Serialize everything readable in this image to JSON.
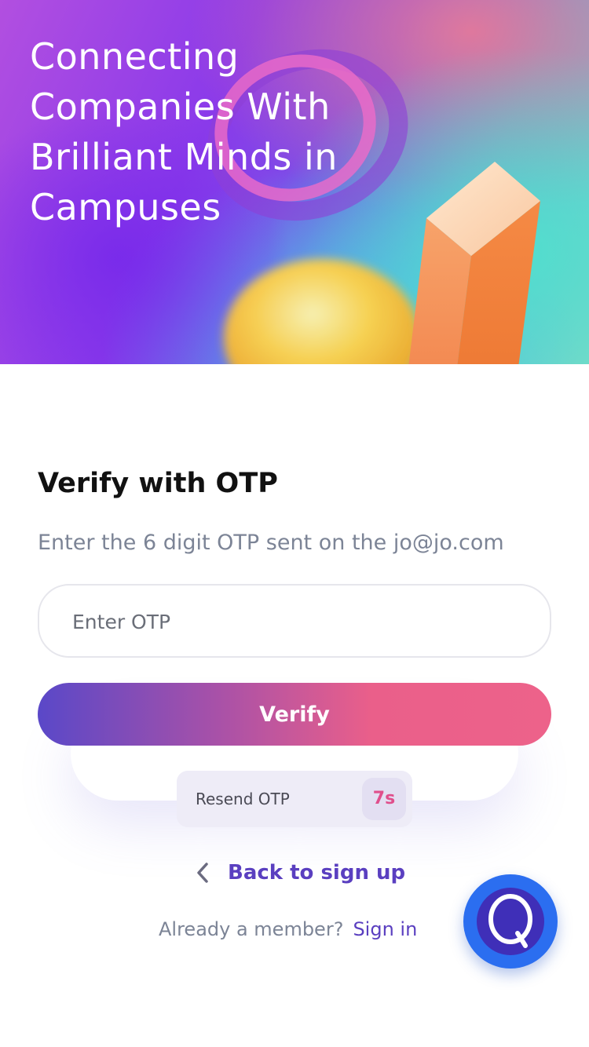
{
  "hero": {
    "title": "Connecting Companies With Brilliant Minds in Campuses"
  },
  "form": {
    "title": "Verify with OTP",
    "subtitle": "Enter the 6 digit OTP sent on the jo@jo.com",
    "otp_placeholder": "Enter OTP",
    "verify_label": "Verify",
    "resend_label": "Resend OTP",
    "resend_timer": "7s",
    "back_label": "Back to sign up",
    "member_prompt": "Already a member?",
    "signin_label": "Sign in"
  },
  "chat": {
    "icon": "chat-q-icon"
  },
  "colors": {
    "accent": "#5a3fc0",
    "button_start": "#5a48c8",
    "button_end": "#ed628a",
    "timer": "#e04f8c",
    "chat_button": "#2b6ef0"
  }
}
